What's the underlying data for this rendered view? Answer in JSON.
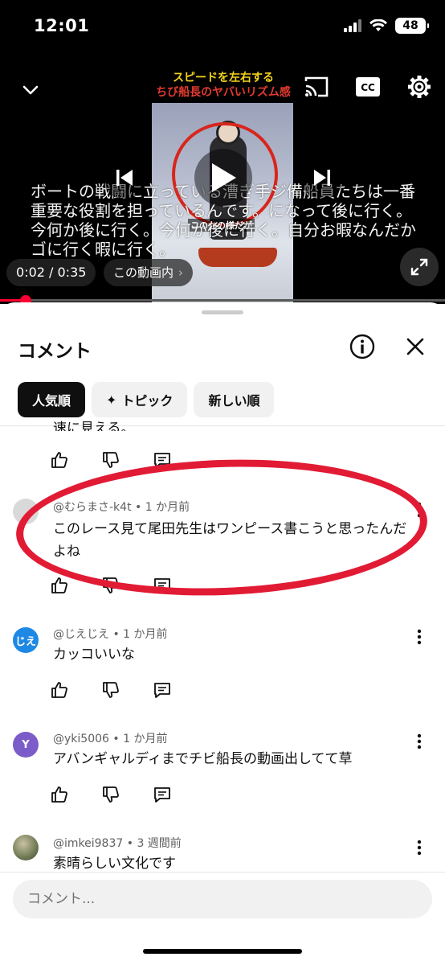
{
  "status_bar": {
    "time": "12:01",
    "battery": "48"
  },
  "video": {
    "title_line1": "スピードを左右する",
    "title_line2": "ちび船長のヤバいリズム感",
    "frame_caption": "このかの様だが",
    "subtitle": "ボートの戦闘に立っている漕ぎ手ジ備船員たちは一番重要な役割を担っているんです。になって後に行く。今何か後に行く。今何か後に行く。自分お暇なんだかゴに行く暇に行く。",
    "time": "0:02 / 0:35",
    "chapter_label": "この動画内",
    "chapter_chevron": "›",
    "progress_fraction": 0.057,
    "cc_label": "CC"
  },
  "comments_panel": {
    "title": "コメント",
    "chips": [
      {
        "label": "人気順",
        "active": true
      },
      {
        "label": "トピック",
        "icon": "✦",
        "active": false
      },
      {
        "label": "新しい順",
        "active": false
      }
    ],
    "partial_text": "速に見える。",
    "comments": [
      {
        "author": "@むらまさ-k4t",
        "age": "1 か月前",
        "text": "このレース見て尾田先生はワンピース書こうと思ったんだよね",
        "avatar_text": "",
        "avatar_color": "#d9d9d9"
      },
      {
        "author": "@じえじえ",
        "age": "1 か月前",
        "text": "カッコいいな",
        "avatar_text": "じえ",
        "avatar_color": "#1e88e5"
      },
      {
        "author": "@yki5006",
        "age": "1 か月前",
        "text": "アバンギャルディまでチビ船長の動画出してて草",
        "avatar_text": "Y",
        "avatar_color": "#7b5cc8"
      },
      {
        "author": "@imkei9837",
        "age": "3 週間前",
        "text": "素晴らしい文化です",
        "avatar_text": "",
        "avatar_color": "#6f7a55"
      }
    ],
    "meta_separator": "•",
    "input_placeholder": "コメント..."
  },
  "colors": {
    "accent_red": "#ff0033",
    "highlight_red": "#e21b35",
    "chip_active": "#0f0f0f"
  }
}
